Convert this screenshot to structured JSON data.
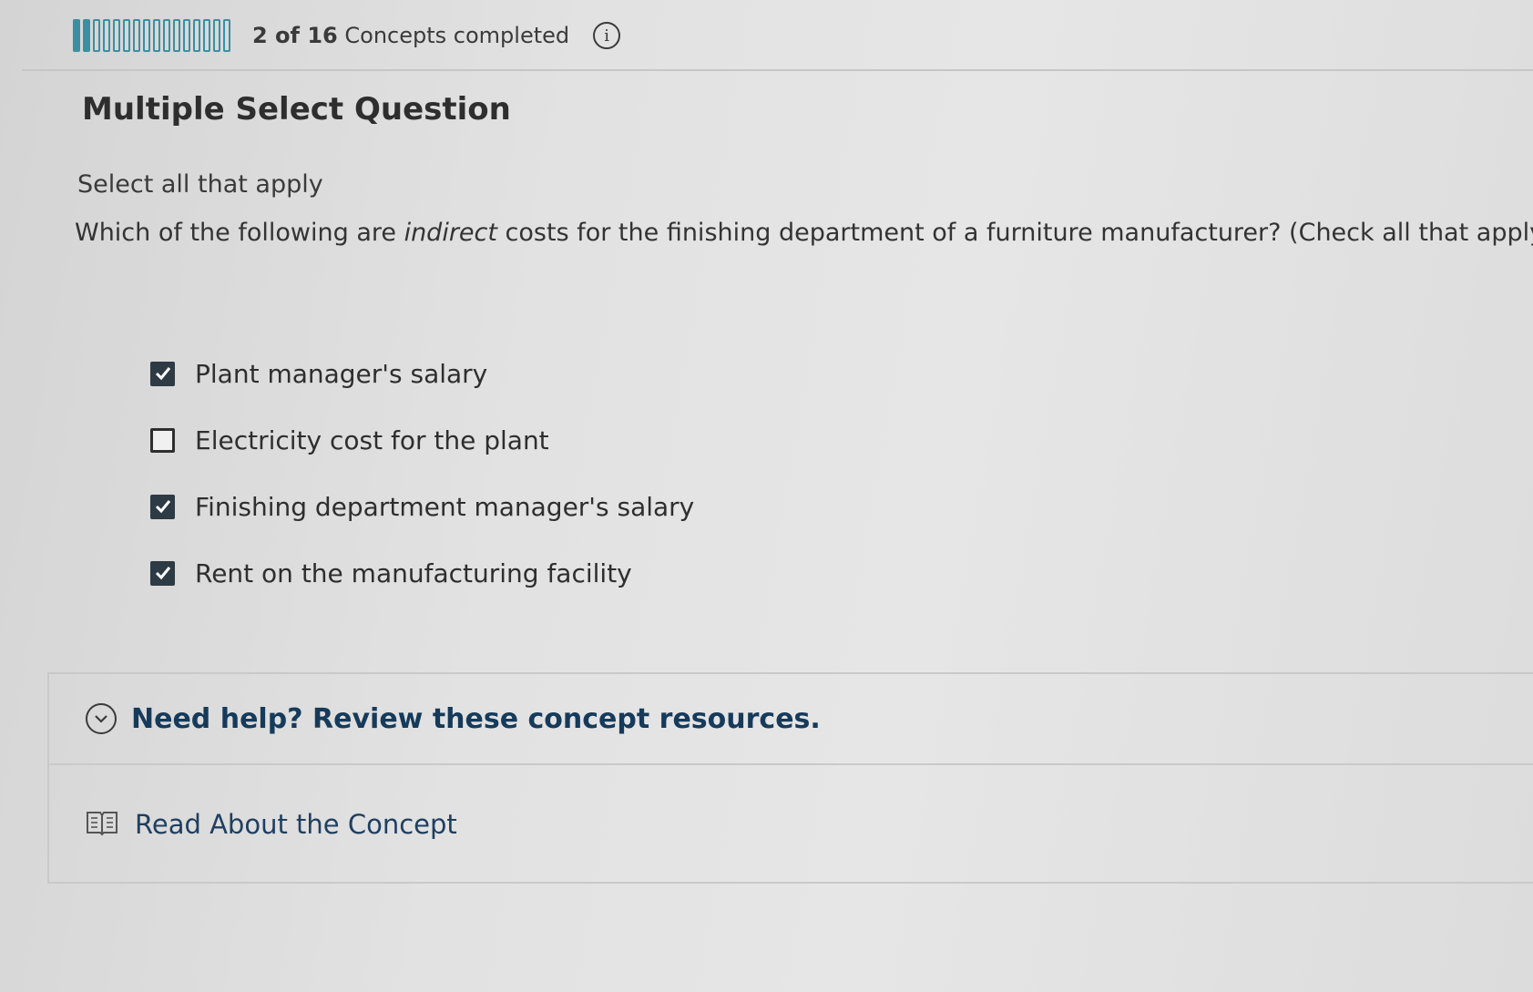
{
  "progress": {
    "completed": 2,
    "total": 16,
    "count_text": "2 of 16",
    "suffix_text": "Concepts completed",
    "info_icon": "info-icon",
    "accent_color": "#3b8fa3"
  },
  "question": {
    "type_label": "Multiple Select Question",
    "instructions": "Select all that apply",
    "prompt_before": "Which of the following are ",
    "prompt_emphasis": "indirect",
    "prompt_after": " costs for the finishing department of a furniture manufacturer? (Check all that apply.)",
    "options": [
      {
        "label": "Plant manager's salary",
        "checked": true
      },
      {
        "label": "Electricity cost for the plant",
        "checked": false
      },
      {
        "label": "Finishing department manager's salary",
        "checked": true
      },
      {
        "label": "Rent on the manufacturing facility",
        "checked": true
      }
    ]
  },
  "help": {
    "title": "Need help? Review these concept resources.",
    "toggle_icon": "chevron-down-icon",
    "resources": [
      {
        "label": "Read About the Concept",
        "icon": "book-icon"
      }
    ],
    "title_color": "#163a5a"
  }
}
